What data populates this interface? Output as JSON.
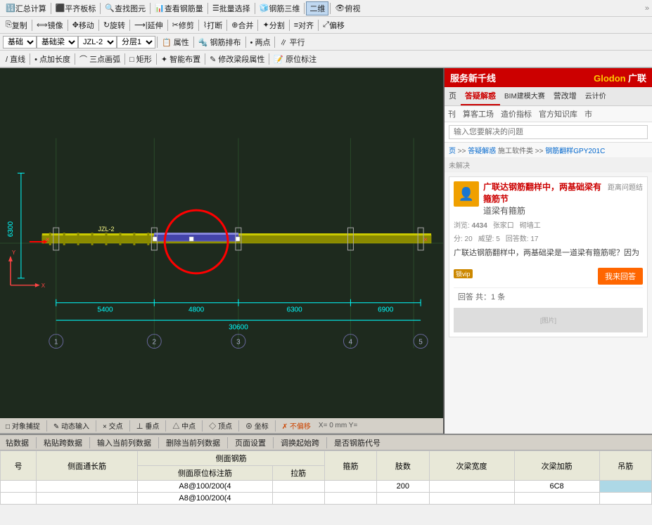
{
  "toolbar": {
    "row1": [
      {
        "label": "汇总计算",
        "icon": "calc"
      },
      {
        "label": "平齐板标",
        "icon": "board"
      },
      {
        "label": "查找图元",
        "icon": "search"
      },
      {
        "label": "查看钢筋量",
        "icon": "rebar"
      },
      {
        "label": "批量选择",
        "icon": "batch"
      },
      {
        "label": "钢筋三维",
        "icon": "3d"
      },
      {
        "label": "二维",
        "icon": "2d"
      },
      {
        "label": "俯视",
        "icon": "top"
      }
    ],
    "row2": [
      {
        "label": "复制"
      },
      {
        "label": "镜像"
      },
      {
        "label": "移动"
      },
      {
        "label": "旋转"
      },
      {
        "label": "延伸"
      },
      {
        "label": "修剪"
      },
      {
        "label": "打断"
      },
      {
        "label": "合并"
      },
      {
        "label": "分割"
      },
      {
        "label": "对齐"
      },
      {
        "label": "偏移"
      }
    ],
    "row3_selects": [
      "基础",
      "基础梁",
      "JZL-2",
      "分层1"
    ],
    "row3_btns": [
      "属性",
      "钢筋排布",
      "两点",
      "平行"
    ],
    "row4": [
      "直线",
      "点加长度",
      "三点画弧",
      "矩形",
      "智能布置",
      "修改梁段属性",
      "原位标注"
    ]
  },
  "cad": {
    "dimensions": {
      "left_height": "6300",
      "spans": [
        "5400",
        "4800",
        "6300",
        "6900"
      ],
      "total": "30600"
    },
    "col_numbers": [
      "1",
      "2",
      "3",
      "4",
      "5"
    ],
    "beam_label": "JZL-2",
    "axis_x": "X",
    "axis_y": "Y"
  },
  "bottom": {
    "toolbar_btns": [
      "对象捕捉",
      "动态输入",
      "交点",
      "垂点",
      "中点",
      "顶点",
      "坐标",
      "不偏移"
    ],
    "toolbar_btns2": [
      "钻数据",
      "粘贴跨数据",
      "输入当前列数据",
      "删除当前列数据",
      "页面设置",
      "调换起始跨",
      "是否钢筋代号"
    ],
    "table": {
      "headers": [
        "号",
        "侧面通长筋",
        "侧面钢筋\n侧面原位标注筋",
        "拉筋",
        "箍筋",
        "肢数",
        "次梁宽度",
        "次梁加筋",
        "吊筋"
      ],
      "col_headers_top": [
        "侧面钢筋",
        ""
      ],
      "col_headers_sub": [
        "侧面原位标注筋",
        "拉筋"
      ],
      "rows": [
        {
          "cells": [
            "",
            "",
            "A8@100/200(4",
            "",
            "",
            "200",
            "6C8",
            "",
            ""
          ]
        },
        {
          "cells": [
            "",
            "",
            "A8@100/200(4",
            "",
            "",
            "",
            "",
            "",
            ""
          ]
        }
      ]
    }
  },
  "right_panel": {
    "logo_left": "服务新千线",
    "logo_right": "Glodon广联",
    "nav_items": [
      "页",
      "答疑解惑",
      "BIM建模大赛",
      "营改增",
      "云计价"
    ],
    "active_nav": "答疑解惑",
    "subnav": [
      "刊",
      "算客工场",
      "造价指标",
      "官方知识库",
      "市"
    ],
    "search_placeholder": "输入您要解决的问题",
    "breadcrumb": "页 >> 答疑解惑  施工软件类 >> 钢筋翻样GPY201C",
    "unresolved_label": "未解决",
    "question": {
      "title": "广联达钢筋翻样中，两基础梁有箍筋节",
      "subtitle": "道梁有箍筋",
      "distance": "距离问题结",
      "body": "广联达钢筋翻样中，两基础梁是一道梁有箍筋呢？因为",
      "stats": [
        {
          "label": "浏览",
          "value": "4434"
        },
        {
          "label": "张家口"
        },
        {
          "label": "砌墙工"
        },
        {
          "label": "分数",
          "value": "20"
        },
        {
          "label": "威望",
          "value": "5"
        },
        {
          "label": "回答数",
          "value": "17"
        }
      ],
      "answer_btn": "我来回答",
      "answer_count": "回答  共：1 条",
      "vip_label": "锁vip"
    }
  },
  "statusbar": {
    "items": [
      "X=",
      "0",
      "mm",
      "Y="
    ]
  }
}
